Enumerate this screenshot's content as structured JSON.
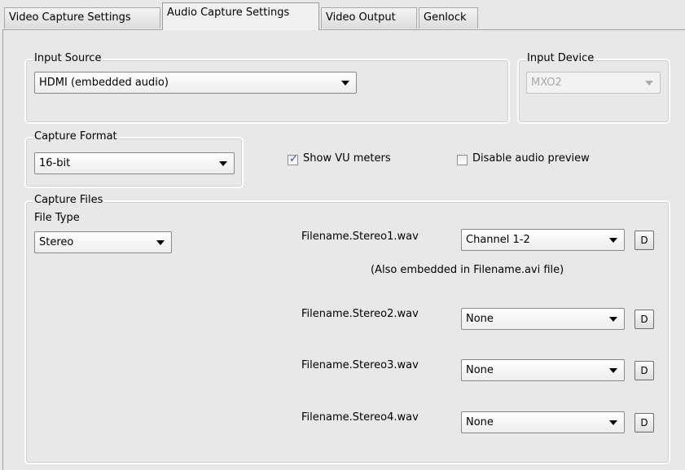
{
  "tabs": [
    "Video Capture Settings",
    "Audio Capture Settings",
    "Video Output",
    "Genlock"
  ],
  "active_tab": "Audio Capture Settings",
  "input_source": {
    "legend": "Input Source",
    "value": "HDMI (embedded audio)"
  },
  "input_device": {
    "legend": "Input Device",
    "value": "MXO2"
  },
  "capture_format": {
    "legend": "Capture Format",
    "value": "16-bit"
  },
  "options": {
    "show_vu": {
      "label": "Show VU meters",
      "checked": true
    },
    "disable_preview": {
      "label": "Disable audio preview",
      "checked": false
    }
  },
  "capture_files": {
    "legend": "Capture Files",
    "file_type_label": "File Type",
    "file_type_value": "Stereo",
    "note": "(Also embedded in Filename.avi file)",
    "rows": [
      {
        "filename": "Filename.Stereo1.wav",
        "channel": "Channel 1-2",
        "button": "D"
      },
      {
        "filename": "Filename.Stereo2.wav",
        "channel": "None",
        "button": "D"
      },
      {
        "filename": "Filename.Stereo3.wav",
        "channel": "None",
        "button": "D"
      },
      {
        "filename": "Filename.Stereo4.wav",
        "channel": "None",
        "button": "D"
      }
    ]
  }
}
